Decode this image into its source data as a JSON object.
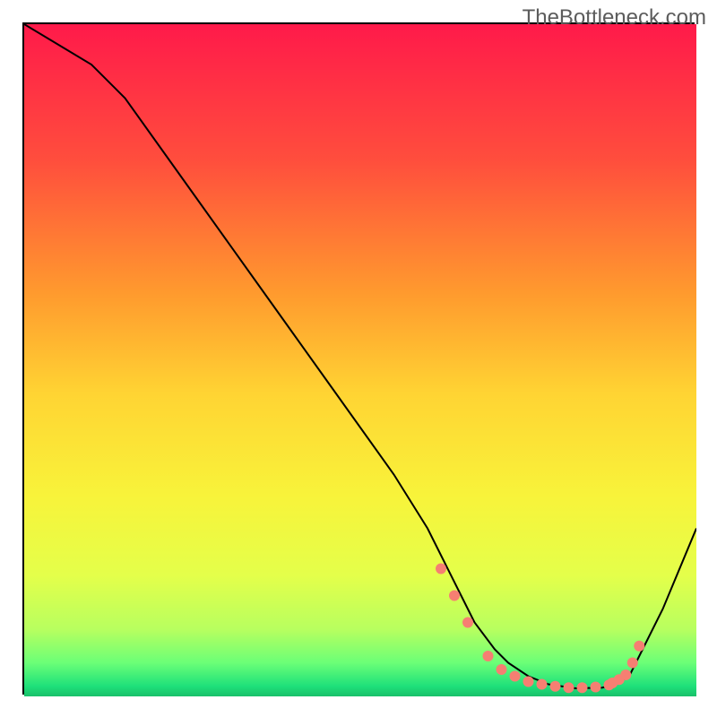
{
  "watermark": "TheBottleneck.com",
  "chart_data": {
    "type": "line",
    "title": "",
    "xlabel": "",
    "ylabel": "",
    "xlim": [
      0,
      100
    ],
    "ylim": [
      0,
      100
    ],
    "background": {
      "type": "vertical-gradient",
      "stops": [
        {
          "pos": 0.0,
          "color": "#ff1a4a"
        },
        {
          "pos": 0.2,
          "color": "#ff4d3d"
        },
        {
          "pos": 0.4,
          "color": "#ff9a2e"
        },
        {
          "pos": 0.55,
          "color": "#ffd433"
        },
        {
          "pos": 0.7,
          "color": "#f8f33a"
        },
        {
          "pos": 0.82,
          "color": "#e4ff4a"
        },
        {
          "pos": 0.9,
          "color": "#b8ff5f"
        },
        {
          "pos": 0.95,
          "color": "#6bff77"
        },
        {
          "pos": 0.985,
          "color": "#1ee07a"
        },
        {
          "pos": 1.0,
          "color": "#19c06a"
        }
      ]
    },
    "series": [
      {
        "name": "curve",
        "x": [
          0,
          5,
          10,
          15,
          20,
          25,
          30,
          35,
          40,
          45,
          50,
          55,
          60,
          62,
          65,
          67,
          70,
          72,
          75,
          78,
          82,
          86,
          88,
          90,
          92,
          95,
          100
        ],
        "y": [
          100,
          97,
          94,
          89,
          82,
          75,
          68,
          61,
          54,
          47,
          40,
          33,
          25,
          21,
          15,
          11,
          7,
          5,
          3,
          1.8,
          1.2,
          1.3,
          1.8,
          3,
          7,
          13,
          25
        ]
      }
    ],
    "markers": {
      "name": "dots",
      "color": "#f67f72",
      "radius": 6,
      "x": [
        62,
        64,
        66,
        69,
        71,
        73,
        75,
        77,
        79,
        81,
        83,
        85,
        87,
        87.5,
        88.5,
        89.5,
        90.5,
        91.5
      ],
      "y": [
        19,
        15,
        11,
        6,
        4,
        3,
        2.2,
        1.8,
        1.5,
        1.3,
        1.3,
        1.4,
        1.7,
        2.0,
        2.5,
        3.2,
        5,
        7.5
      ]
    }
  }
}
